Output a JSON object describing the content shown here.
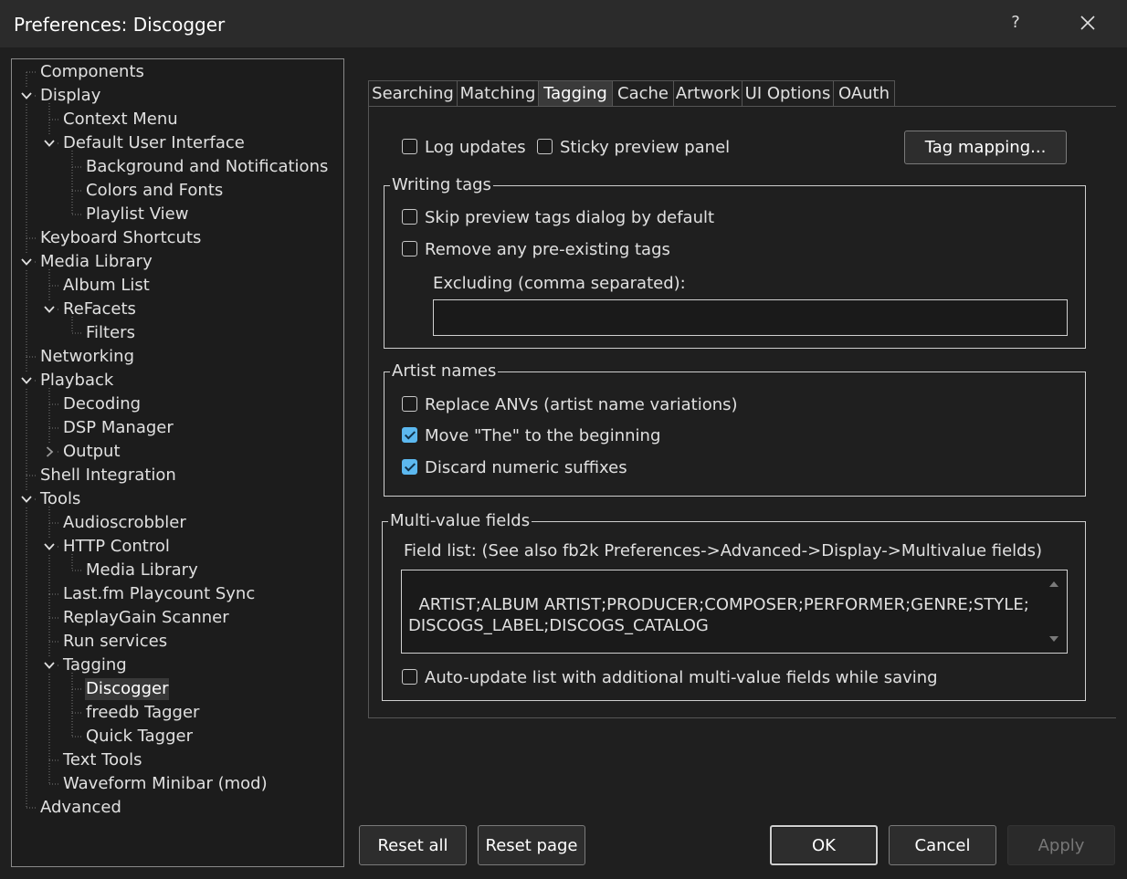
{
  "window": {
    "title": "Preferences: Discogger",
    "help_label": "?"
  },
  "tree": {
    "items": [
      {
        "label": "Components",
        "depth": 0
      },
      {
        "label": "Display",
        "depth": 0,
        "toggle": "expanded"
      },
      {
        "label": "Context Menu",
        "depth": 1
      },
      {
        "label": "Default User Interface",
        "depth": 1,
        "toggle": "expanded"
      },
      {
        "label": "Background and Notifications",
        "depth": 2
      },
      {
        "label": "Colors and Fonts",
        "depth": 2
      },
      {
        "label": "Playlist View",
        "depth": 2
      },
      {
        "label": "Keyboard Shortcuts",
        "depth": 0
      },
      {
        "label": "Media Library",
        "depth": 0,
        "toggle": "expanded"
      },
      {
        "label": "Album List",
        "depth": 1
      },
      {
        "label": "ReFacets",
        "depth": 1,
        "toggle": "expanded"
      },
      {
        "label": "Filters",
        "depth": 2
      },
      {
        "label": "Networking",
        "depth": 0
      },
      {
        "label": "Playback",
        "depth": 0,
        "toggle": "expanded"
      },
      {
        "label": "Decoding",
        "depth": 1
      },
      {
        "label": "DSP Manager",
        "depth": 1
      },
      {
        "label": "Output",
        "depth": 1,
        "toggle": "collapsed"
      },
      {
        "label": "Shell Integration",
        "depth": 0
      },
      {
        "label": "Tools",
        "depth": 0,
        "toggle": "expanded"
      },
      {
        "label": "Audioscrobbler",
        "depth": 1
      },
      {
        "label": "HTTP Control",
        "depth": 1,
        "toggle": "expanded"
      },
      {
        "label": "Media Library",
        "depth": 2
      },
      {
        "label": "Last.fm Playcount Sync",
        "depth": 1
      },
      {
        "label": "ReplayGain Scanner",
        "depth": 1
      },
      {
        "label": "Run services",
        "depth": 1
      },
      {
        "label": "Tagging",
        "depth": 1,
        "toggle": "expanded"
      },
      {
        "label": "Discogger",
        "depth": 2,
        "selected": true
      },
      {
        "label": "freedb Tagger",
        "depth": 2
      },
      {
        "label": "Quick Tagger",
        "depth": 2
      },
      {
        "label": "Text Tools",
        "depth": 1
      },
      {
        "label": "Waveform Minibar (mod)",
        "depth": 1
      },
      {
        "label": "Advanced",
        "depth": 0
      }
    ]
  },
  "tabs": [
    {
      "label": "Searching"
    },
    {
      "label": "Matching"
    },
    {
      "label": "Tagging",
      "active": true
    },
    {
      "label": "Cache"
    },
    {
      "label": "Artwork"
    },
    {
      "label": "UI Options"
    },
    {
      "label": "OAuth"
    }
  ],
  "options": {
    "log_updates": {
      "label": "Log updates",
      "checked": false
    },
    "sticky_preview": {
      "label": "Sticky preview panel",
      "checked": false
    },
    "tag_mapping_label": "Tag mapping..."
  },
  "writing_tags": {
    "title": "Writing tags",
    "skip_preview": {
      "label": "Skip preview tags dialog by default",
      "checked": false
    },
    "remove_existing": {
      "label": "Remove any pre-existing tags",
      "checked": false
    },
    "excluding_label": "Excluding (comma separated):",
    "excluding_value": ""
  },
  "artist_names": {
    "title": "Artist names",
    "replace_anvs": {
      "label": "Replace ANVs (artist name variations)",
      "checked": false
    },
    "move_the": {
      "label": "Move \"The\" to the beginning",
      "checked": true
    },
    "discard_suffixes": {
      "label": "Discard numeric suffixes",
      "checked": true
    }
  },
  "multi_value": {
    "title": "Multi-value fields",
    "field_list_label": "Field list: (See also fb2k Preferences->Advanced->Display->Multivalue fields)",
    "field_list_value": "ARTIST;ALBUM ARTIST;PRODUCER;COMPOSER;PERFORMER;GENRE;STYLE;DISCOGS_LABEL;DISCOGS_CATALOG",
    "auto_update": {
      "label": "Auto-update list with additional multi-value fields while saving",
      "checked": false
    }
  },
  "footer": {
    "reset_all": "Reset all",
    "reset_page": "Reset page",
    "ok": "OK",
    "cancel": "Cancel",
    "apply": "Apply"
  },
  "colors": {
    "background": "#1f1f1f",
    "titlebar": "#2b2b2b",
    "accent": "#5cb8ef",
    "selection": "#383838"
  }
}
